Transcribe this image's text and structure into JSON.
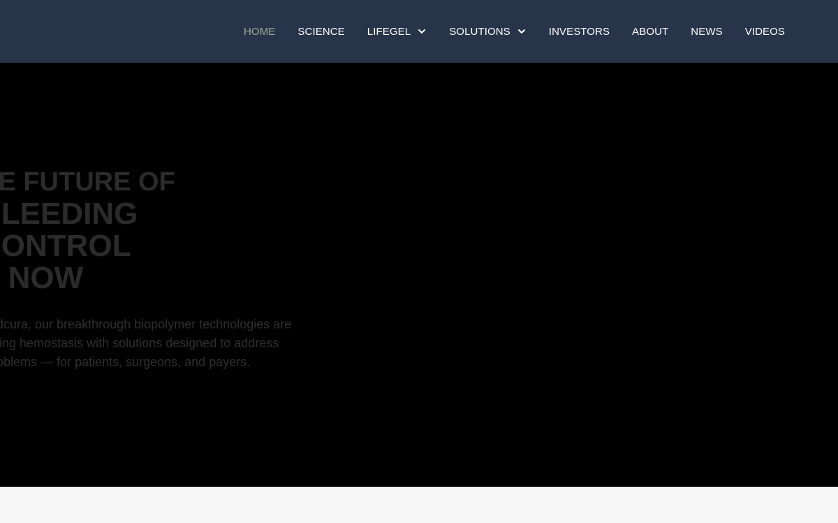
{
  "nav": {
    "items": [
      {
        "label": "HOME",
        "active": true,
        "dropdown": false
      },
      {
        "label": "SCIENCE",
        "active": false,
        "dropdown": false
      },
      {
        "label": "LIFEGEL",
        "active": false,
        "dropdown": true
      },
      {
        "label": "SOLUTIONS",
        "active": false,
        "dropdown": true
      },
      {
        "label": "INVESTORS",
        "active": false,
        "dropdown": false
      },
      {
        "label": "ABOUT",
        "active": false,
        "dropdown": false
      },
      {
        "label": "NEWS",
        "active": false,
        "dropdown": false
      },
      {
        "label": "VIDEOS",
        "active": false,
        "dropdown": false
      }
    ]
  },
  "hero": {
    "title_lines": [
      "HE FUTURE OF",
      "BLEEDING",
      "CONTROL",
      "S NOW"
    ],
    "text_lines": [
      "Medcura, our breakthrough biopolymer technologies are",
      "efining hemostasis with solutions designed to address",
      "l problems — for patients, surgeons, and payers."
    ]
  },
  "colors": {
    "nav_background": "#28344a",
    "nav_text": "#ffffff",
    "nav_active": "#9bab95",
    "hero_background": "#000000",
    "hero_text": "#2b2b2b",
    "page_background": "#f7f7f7"
  },
  "icons": {
    "dropdown": "chevron-down-icon"
  }
}
